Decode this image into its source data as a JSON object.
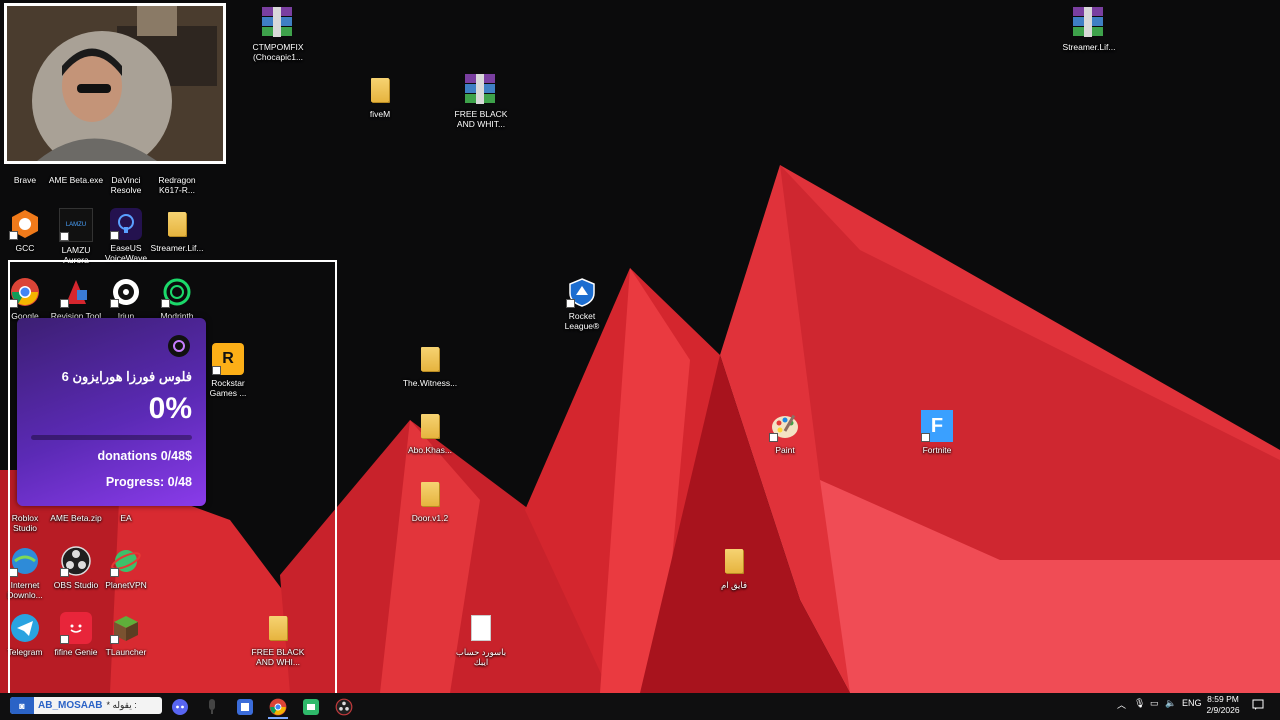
{
  "desktop_icons": {
    "ctmpomfix": "CTMPOMFIX\n(Chocapic1...",
    "streamer_life_top": "Streamer.Lif...",
    "fivem": "fiveM",
    "free_black_top": "FREE BLACK\nAND WHIT...",
    "brave": "Brave",
    "ame_beta_exe": "AME Beta.exe",
    "davinci": "DaVinci\nResolve",
    "redragon": "Redragon\nK617-R...",
    "gcc": "GCC",
    "lamzu": "LAMZU\nAurora",
    "easeus": "EaseUS\nVoiceWave",
    "streamer_life_folder": "Streamer.Lif...",
    "google_chrome": "Google\nCh",
    "revision_tool": "Revision Tool",
    "iriun": "Iriun",
    "modrinth": "Modrinth",
    "rockstar": "Rockstar\nGames ...",
    "rocket_league": "Rocket\nLeague®",
    "the_witness": "The.Witness...",
    "abo_khas": "Abo.Khas...",
    "door": "Door.v1.2",
    "paint": "Paint",
    "fortnite": "Fortnite",
    "roblox": "Roblox\nStudio",
    "ame_beta_zip": "AME Beta.zip",
    "ea": "EA",
    "internet_download": "Internet\nDownlo...",
    "obs": "OBS Studio",
    "planetvpn": "PlanetVPN",
    "faiq_am": "فايق ام",
    "telegram": "Telegram",
    "fifine": "fifine Genie",
    "tlauncher": "TLauncher",
    "free_black_bottom": "FREE BLACK\nAND WHI...",
    "password_file": "باسورد حساب\nايبك"
  },
  "donation_widget": {
    "title": "فلوس فورزا هورايزون 6",
    "percent_text": "0%",
    "progress_fraction": 0.0,
    "donations_text": "donations 0/48$",
    "progress_text": "Progress: 0/48"
  },
  "taskbar": {
    "chat_user": "AB_MOSAAB",
    "chat_said": ": يقوله *",
    "language": "ENG",
    "time": "8:59 PM",
    "date": "2/9/2026"
  },
  "colors": {
    "wallpaper_red": "#d8262e",
    "widget_purple": "#5b2ab5",
    "folder_yellow": "#f0c75a"
  }
}
